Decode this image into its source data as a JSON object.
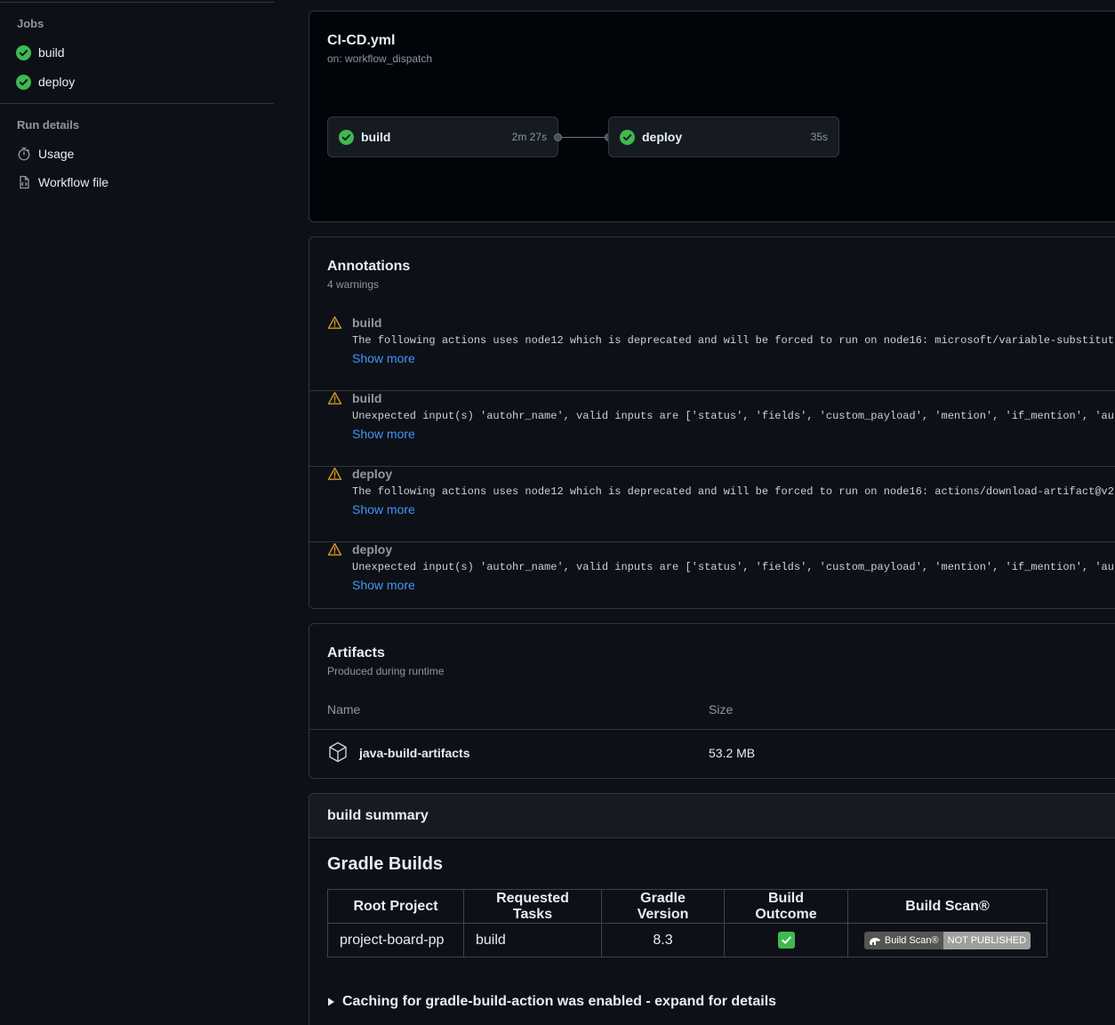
{
  "sidebar": {
    "jobs_heading": "Jobs",
    "jobs": [
      {
        "label": "build",
        "icon": "check-circle-icon"
      },
      {
        "label": "deploy",
        "icon": "check-circle-icon"
      }
    ],
    "run_details_heading": "Run details",
    "run_details": [
      {
        "label": "Usage",
        "icon": "stopwatch-icon"
      },
      {
        "label": "Workflow file",
        "icon": "file-code-icon"
      }
    ]
  },
  "workflow": {
    "title": "CI-CD.yml",
    "trigger": "on: workflow_dispatch",
    "jobs": [
      {
        "name": "build",
        "duration": "2m 27s",
        "status": "success"
      },
      {
        "name": "deploy",
        "duration": "35s",
        "status": "success"
      }
    ]
  },
  "annotations": {
    "title": "Annotations",
    "subtitle": "4 warnings",
    "show_more_label": "Show more",
    "items": [
      {
        "job": "build",
        "message": "The following actions uses node12 which is deprecated and will be forced to run on node16: microsoft/variable-substitut"
      },
      {
        "job": "build",
        "message": "Unexpected input(s) 'autohr_name', valid inputs are ['status', 'fields', 'custom_payload', 'mention', 'if_mention', 'au"
      },
      {
        "job": "deploy",
        "message": "The following actions uses node12 which is deprecated and will be forced to run on node16: actions/download-artifact@v2"
      },
      {
        "job": "deploy",
        "message": "Unexpected input(s) 'autohr_name', valid inputs are ['status', 'fields', 'custom_payload', 'mention', 'if_mention', 'au"
      }
    ]
  },
  "artifacts": {
    "title": "Artifacts",
    "subtitle": "Produced during runtime",
    "columns": {
      "name": "Name",
      "size": "Size"
    },
    "rows": [
      {
        "name": "java-build-artifacts",
        "size": "53.2 MB",
        "icon": "package-icon"
      }
    ]
  },
  "summary": {
    "header": "build summary",
    "heading": "Gradle Builds",
    "table": {
      "headers": [
        "Root Project",
        "Requested Tasks",
        "Gradle Version",
        "Build Outcome",
        "Build Scan®"
      ],
      "row": {
        "root_project": "project-board-pp",
        "requested_tasks": "build",
        "gradle_version": "8.3",
        "build_outcome_icon": "green-check-emoji",
        "scan_badge_left": "Build Scan®",
        "scan_badge_right": "NOT PUBLISHED"
      }
    },
    "details_label": "Caching for gradle-build-action was enabled - expand for details"
  },
  "colors": {
    "background": "#0d1117",
    "success": "#3fb950",
    "warning": "#d29922",
    "link": "#4493f8",
    "border": "#30363d"
  }
}
